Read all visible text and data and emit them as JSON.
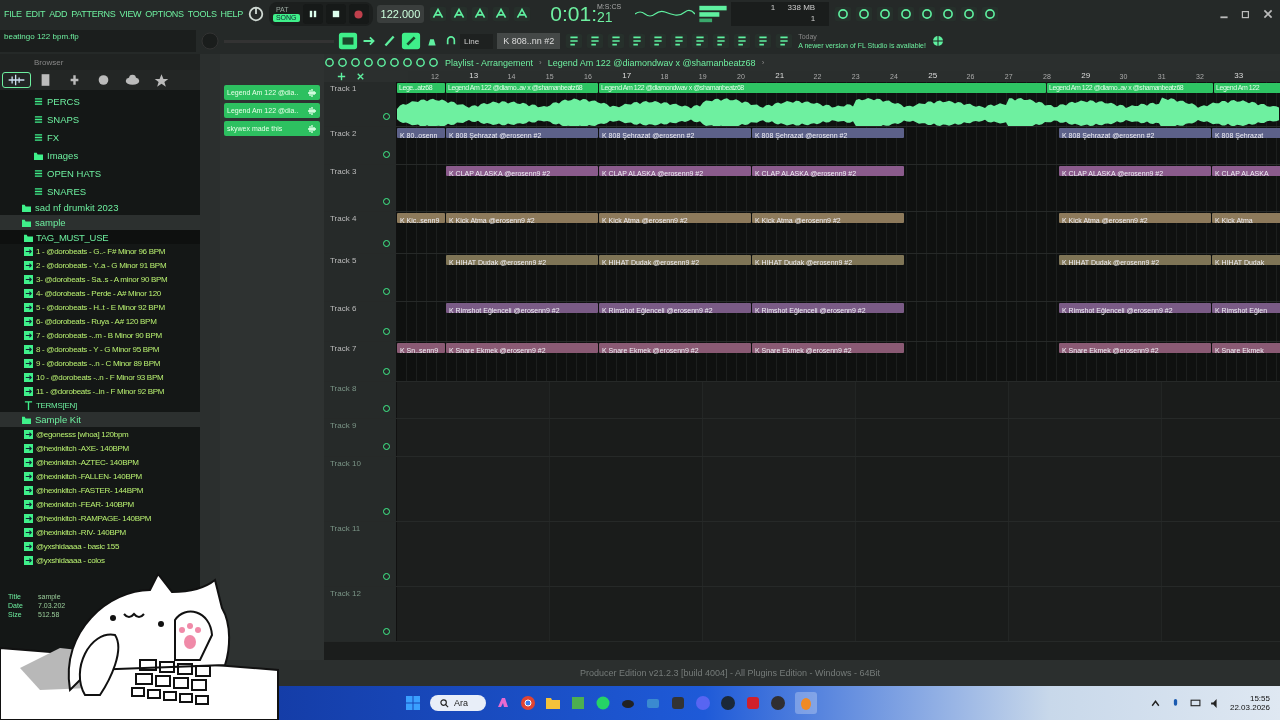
{
  "menu": [
    "FILE",
    "EDIT",
    "ADD",
    "PATTERNS",
    "VIEW",
    "OPTIONS",
    "TOOLS",
    "HELP"
  ],
  "transport": {
    "pat": "PAT",
    "song": "SONG",
    "song_selected": true,
    "recording": false,
    "tempo": "122.000"
  },
  "clock": {
    "time": "0:01:",
    "cs": "21",
    "unit": "M:S:CS"
  },
  "cpu": {
    "value": "1",
    "memory": "338 MB",
    "polyphony": "1"
  },
  "file_name": "beatingo 122 bpm.flp",
  "snap": "Line",
  "pattern": "K 808..nn #2",
  "news": {
    "when": "Today",
    "text": "A newer version of FL Studio is available!"
  },
  "browser": {
    "title": "Browser",
    "tree": [
      {
        "label": "PERCS",
        "kind": "pack"
      },
      {
        "label": "SNAPS",
        "kind": "pack"
      },
      {
        "label": "FX",
        "kind": "pack"
      },
      {
        "label": "Images",
        "kind": "folder-in"
      },
      {
        "label": "OPEN HATS",
        "kind": "pack"
      },
      {
        "label": "SNARES",
        "kind": "pack"
      },
      {
        "label": "sad nf drumkit 2023",
        "kind": "folder",
        "expanded": false
      },
      {
        "label": "sample",
        "kind": "folder",
        "expanded": true,
        "children": [
          {
            "label": "TAG_MUST_USE",
            "kind": "folder"
          },
          {
            "label": "1 - @dorobeats - G..- F# Minor 96 BPM",
            "kind": "file"
          },
          {
            "label": "2 - @dorobeats - Y..a - G Minor 91 BPM",
            "kind": "file"
          },
          {
            "label": "3- @dorobeats - Sa..s - A minor 90 BPM",
            "kind": "file"
          },
          {
            "label": "4- @dorobeats - Perde - A# Minor 120",
            "kind": "file"
          },
          {
            "label": "5 - @dorobeats - H..t - E Minor 92 BPM",
            "kind": "file"
          },
          {
            "label": "6- @dorobeats - Ruya - A# 120 BPM",
            "kind": "file"
          },
          {
            "label": "7 - @dorobeats -..m - B Minor 90 BPM",
            "kind": "file"
          },
          {
            "label": "8 - @dorobeats - Y - G Minor 95 BPM",
            "kind": "file"
          },
          {
            "label": "9 - @dorobeats -..n - C Minor 89 BPM",
            "kind": "file"
          },
          {
            "label": "10 - @dorobeats -..n - F Minor 93 BPM",
            "kind": "file"
          },
          {
            "label": "11 - @dorobeats -..in - F Minor 92 BPM",
            "kind": "file"
          },
          {
            "label": "TERMS[EN]",
            "kind": "text"
          }
        ]
      },
      {
        "label": "Sample Kit",
        "kind": "folder",
        "expanded": true,
        "children": [
          {
            "label": "@egonesss [whoa] 120bpm",
            "kind": "file"
          },
          {
            "label": "@hexinkitch -AXE- 140BPM",
            "kind": "file"
          },
          {
            "label": "@hexinkitch -AZTEC- 140BPM",
            "kind": "file"
          },
          {
            "label": "@hexinkitch -FALLEN- 140BPM",
            "kind": "file"
          },
          {
            "label": "@hexinkitch -FASTER- 144BPM",
            "kind": "file"
          },
          {
            "label": "@hexinkitch -FEAR- 140BPM",
            "kind": "file"
          },
          {
            "label": "@hexinkitch -RAMPAGE- 140BPM",
            "kind": "file"
          },
          {
            "label": "@hexinkitch -RIV- 140BPM",
            "kind": "file"
          },
          {
            "label": "@yxshidaaaa - basic 155",
            "kind": "file"
          },
          {
            "label": "@yxshidaaaa - colos",
            "kind": "file"
          }
        ]
      }
    ],
    "info": [
      {
        "key": "Title",
        "value": "sample"
      },
      {
        "key": "Date",
        "value": "7.03.202"
      },
      {
        "key": "Size",
        "value": "512.58"
      }
    ]
  },
  "clip_list": [
    "Legend Am 122 @dia..",
    "Legend Am 122 @dia..",
    "skywex made this"
  ],
  "playlist": {
    "title": "Playlist - Arrangement",
    "separator": "›",
    "end_arrow": "›",
    "song": "Legend Am 122 @diamondwav x @shamanbeatz68",
    "bars": [
      "12",
      "13",
      "14",
      "15",
      "16",
      "17",
      "18",
      "19",
      "20",
      "21",
      "22",
      "23",
      "24",
      "25",
      "26",
      "27",
      "28",
      "29",
      "30",
      "31",
      "32",
      "33"
    ],
    "tracks": [
      {
        "name": "Track 1",
        "kind": "audio",
        "clips": [
          "Lege...atz68",
          "Legend Am 122 @diamo..av x @shamanbeatz68",
          "Legend Am 122 @diamondwav x @shamanbeatz68",
          "Legend Am 122 @diamo..av x @shamanbeatz68",
          "Legend Am 122"
        ]
      },
      {
        "name": "Track 2",
        "kind": "pattern",
        "color": "#5c6189",
        "starts_late": false,
        "clips": [
          "K 80..osenn",
          "K 808 Şehrazat @erosenn #2",
          "K 808 Şehrazat @erosenn #2",
          "K 808 Şehrazat @erosenn #2",
          "K 808 Şehrazat @erosenn #2",
          "K 808 Şehrazat"
        ]
      },
      {
        "name": "Track 3",
        "kind": "pattern",
        "color": "#8a5b8c",
        "starts_late": true,
        "clips": [
          "K CLAP ALASKA @erosenn9 #2",
          "K CLAP ALASKA @erosenn9 #2",
          "K CLAP ALASKA @erosenn9 #2",
          "K CLAP ALASKA @erosenn9 #2",
          "K CLAP ALASKA"
        ]
      },
      {
        "name": "Track 4",
        "kind": "pattern",
        "color": "#8d7a5b",
        "starts_late": false,
        "clips": [
          "K Kic..senn9",
          "K Kick Atma @erosenn9 #2",
          "K Kick Atma @erosenn9 #2",
          "K Kick Atma @erosenn9 #2",
          "K Kick Atma @erosenn9 #2",
          "K Kick Atma"
        ]
      },
      {
        "name": "Track 5",
        "kind": "pattern",
        "color": "#7f7556",
        "starts_late": true,
        "clips": [
          "K HIHAT Dudak @erosenn9 #2",
          "K HIHAT Dudak @erosenn9 #2",
          "K HIHAT Dudak @erosenn9 #2",
          "K HIHAT Dudak @erosenn9 #2",
          "K HIHAT Dudak"
        ]
      },
      {
        "name": "Track 6",
        "kind": "pattern",
        "color": "#7a5b86",
        "starts_late": true,
        "clips": [
          "K Rimshot Eğlenceli @erosenn9 #2",
          "K Rimshot Eğlenceli @erosenn9 #2",
          "K Rimshot Eğlenceli @erosenn9 #2",
          "K Rimshot Eğlenceli @erosenn9 #2",
          "K Rimshot Eğlen"
        ]
      },
      {
        "name": "Track 7",
        "kind": "pattern",
        "color": "#8a5a74",
        "starts_late": false,
        "clips": [
          "K Sn..senn9",
          "K Snare Ekmek @erosenn9 #2",
          "K Snare Ekmek @erosenn9 #2",
          "K Snare Ekmek @erosenn9 #2",
          "K Snare Ekmek @erosenn9 #2",
          "K Snare Ekmek"
        ]
      },
      {
        "name": "Track 8",
        "kind": "empty"
      },
      {
        "name": "Track 9",
        "kind": "empty"
      },
      {
        "name": "Track 10",
        "kind": "empty"
      },
      {
        "name": "Track 11",
        "kind": "empty"
      },
      {
        "name": "Track 12",
        "kind": "empty"
      }
    ]
  },
  "status": "Producer Edition v21.2.3 [build 4004] - All Plugins Edition - Windows - 64Bit",
  "taskbar": {
    "search": "Ara",
    "time": "15:55",
    "date": "22.03.2026"
  }
}
